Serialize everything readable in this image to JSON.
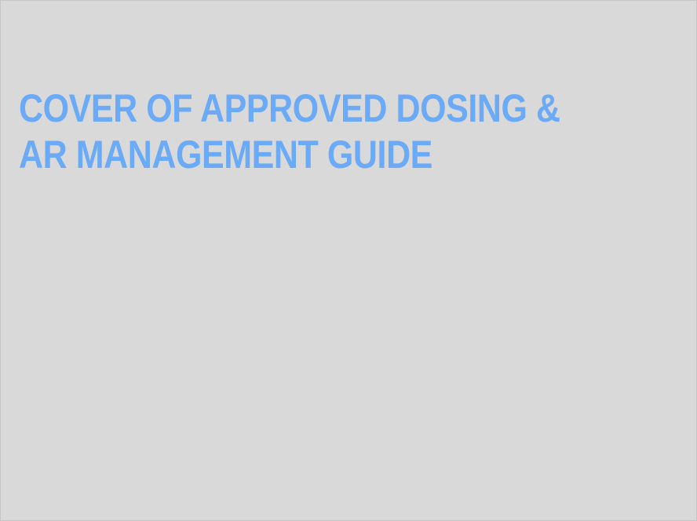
{
  "placeholder": {
    "title_lines": [
      "COVER OF APPROVED DOSING &",
      "AR MANAGEMENT GUIDE"
    ],
    "title_color": "#6aaaf6",
    "background_color": "#d9d9d9"
  }
}
